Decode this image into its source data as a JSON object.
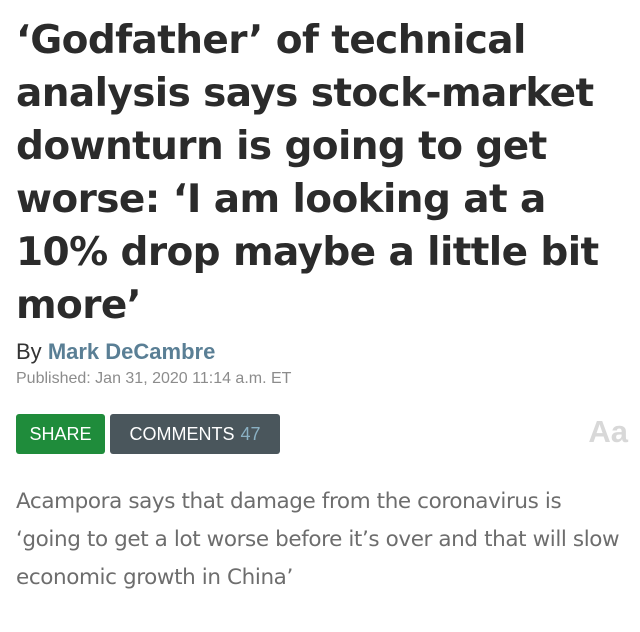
{
  "article": {
    "headline": "‘Godfather’ of technical analysis says stock-market downturn is going to get worse: ‘I am looking at a 10% drop maybe a little bit more’",
    "byline_prefix": "By",
    "author": "Mark DeCambre",
    "published": "Published: Jan 31, 2020 11:14 a.m. ET",
    "dek": "Acampora says that damage from the coronavirus is ‘going to get a lot worse before it’s over and that will slow economic growth in China’"
  },
  "actions": {
    "share_label": "SHARE",
    "comments_label": "COMMENTS",
    "comments_count": "47",
    "text_size_label": "Aa"
  },
  "colors": {
    "headline": "#2b2b2b",
    "author_link": "#5a7f95",
    "share_button": "#1f8c3b",
    "comments_button": "#4a565c",
    "comments_count": "#8ab0c3",
    "dek_text": "#6d6d6d"
  }
}
